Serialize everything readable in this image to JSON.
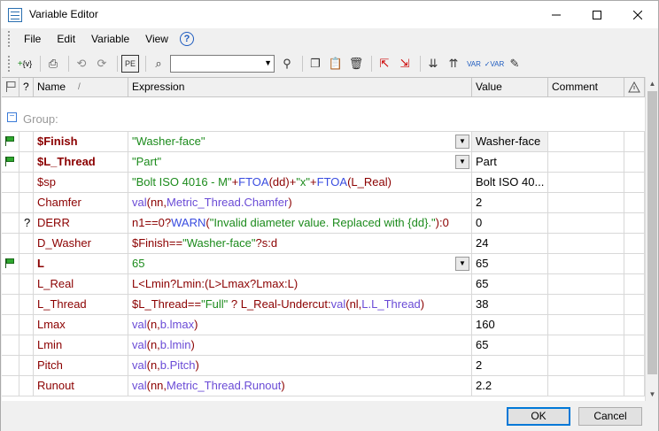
{
  "window": {
    "title": "Variable Editor"
  },
  "menu": [
    "File",
    "Edit",
    "Variable",
    "View"
  ],
  "search": {
    "value": ""
  },
  "columns": {
    "name": "Name",
    "expression": "Expression",
    "value": "Value",
    "comment": "Comment",
    "q": "?"
  },
  "group": {
    "label": "Group:"
  },
  "rows": [
    {
      "flag": true,
      "q": "",
      "name": "$Finish",
      "bold": true,
      "combo": true,
      "expr": [
        [
          "str",
          "\"Washer-face\""
        ]
      ],
      "value": "Washer-face",
      "valbg": true
    },
    {
      "flag": true,
      "q": "",
      "name": "$L_Thread",
      "bold": true,
      "combo": true,
      "expr": [
        [
          "str",
          "\"Part\""
        ]
      ],
      "value": "Part"
    },
    {
      "flag": false,
      "q": "",
      "name": "$sp",
      "bold": false,
      "combo": false,
      "expr": [
        [
          "str",
          "\"Bolt ISO 4016 - M\""
        ],
        [
          "p",
          "+"
        ],
        [
          "kw",
          "FTOA"
        ],
        [
          "nm",
          "(dd)"
        ],
        [
          "p",
          "+"
        ],
        [
          "str",
          "\"x\""
        ],
        [
          "p",
          "+"
        ],
        [
          "kw",
          "FTOA"
        ],
        [
          "nm",
          "(L_Real)"
        ]
      ],
      "value": "Bolt ISO 40..."
    },
    {
      "flag": false,
      "q": "",
      "name": "Chamfer",
      "bold": false,
      "combo": false,
      "expr": [
        [
          "fn",
          "val"
        ],
        [
          "nm",
          "(nn,"
        ],
        [
          "fn",
          "Metric_Thread.Chamfer"
        ],
        [
          "nm",
          ")"
        ]
      ],
      "value": "2"
    },
    {
      "flag": false,
      "q": "?",
      "name": "DERR",
      "bold": false,
      "combo": false,
      "expr": [
        [
          "nm",
          "n1==0?"
        ],
        [
          "kw",
          "WARN"
        ],
        [
          "nm",
          "("
        ],
        [
          "str",
          "\"Invalid diameter value. Replaced with {dd}.\""
        ],
        [
          "nm",
          "):0"
        ]
      ],
      "value": "0"
    },
    {
      "flag": false,
      "q": "",
      "name": "D_Washer",
      "bold": false,
      "combo": false,
      "expr": [
        [
          "nm",
          "$Finish=="
        ],
        [
          "str",
          "\"Washer-face\""
        ],
        [
          "nm",
          "?s:d"
        ]
      ],
      "value": "24"
    },
    {
      "flag": true,
      "q": "",
      "name": "L",
      "bold": true,
      "combo": true,
      "expr": [
        [
          "str",
          "65"
        ]
      ],
      "value": "65"
    },
    {
      "flag": false,
      "q": "",
      "name": "L_Real",
      "bold": false,
      "combo": false,
      "expr": [
        [
          "nm",
          "L<Lmin?Lmin:(L>Lmax?Lmax:L)"
        ]
      ],
      "value": "65"
    },
    {
      "flag": false,
      "q": "",
      "name": "L_Thread",
      "bold": false,
      "combo": false,
      "expr": [
        [
          "nm",
          "$L_Thread=="
        ],
        [
          "str",
          "\"Full\""
        ],
        [
          "nm",
          " ? L_Real-Undercut:"
        ],
        [
          "fn",
          "val"
        ],
        [
          "nm",
          "(nl,"
        ],
        [
          "fn",
          "L.L_Thread"
        ],
        [
          "nm",
          ")"
        ]
      ],
      "value": "38"
    },
    {
      "flag": false,
      "q": "",
      "name": "Lmax",
      "bold": false,
      "combo": false,
      "expr": [
        [
          "fn",
          "val"
        ],
        [
          "nm",
          "(n,"
        ],
        [
          "fn",
          "b.lmax"
        ],
        [
          "nm",
          ")"
        ]
      ],
      "value": "160"
    },
    {
      "flag": false,
      "q": "",
      "name": "Lmin",
      "bold": false,
      "combo": false,
      "expr": [
        [
          "fn",
          "val"
        ],
        [
          "nm",
          "(n,"
        ],
        [
          "fn",
          "b.lmin"
        ],
        [
          "nm",
          ")"
        ]
      ],
      "value": "65"
    },
    {
      "flag": false,
      "q": "",
      "name": "Pitch",
      "bold": false,
      "combo": false,
      "expr": [
        [
          "fn",
          "val"
        ],
        [
          "nm",
          "(n,"
        ],
        [
          "fn",
          "b.Pitch"
        ],
        [
          "nm",
          ")"
        ]
      ],
      "value": "2"
    },
    {
      "flag": false,
      "q": "",
      "name": "Runout",
      "bold": false,
      "combo": false,
      "expr": [
        [
          "fn",
          "val"
        ],
        [
          "nm",
          "(nn,"
        ],
        [
          "fn",
          "Metric_Thread.Runout"
        ],
        [
          "nm",
          ")"
        ]
      ],
      "value": "2.2"
    }
  ],
  "buttons": {
    "ok": "OK",
    "cancel": "Cancel"
  },
  "colors": {
    "name": "#8b0000",
    "string": "#1c8b1c",
    "function": "#6a4bd6",
    "keyword": "#3a4de0",
    "flag": "#2ea82e",
    "focus": "#0078d7"
  }
}
